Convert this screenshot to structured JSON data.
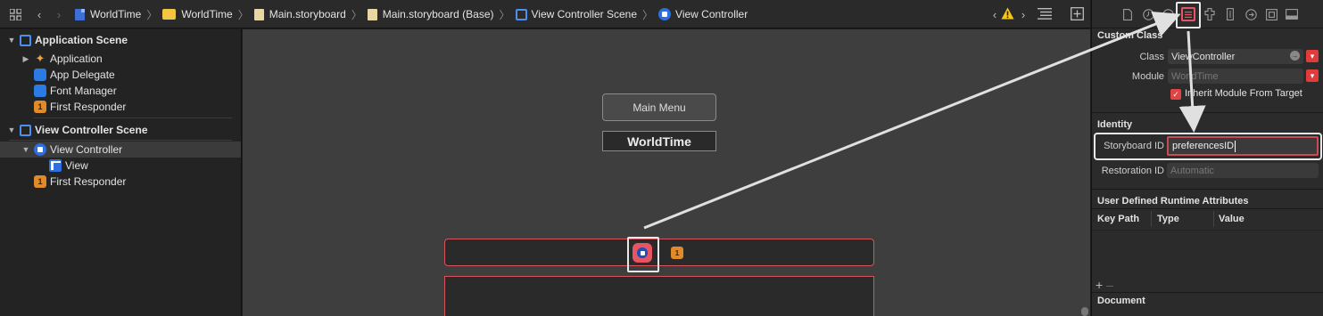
{
  "jumpbar": {
    "crumbs": [
      "WorldTime",
      "WorldTime",
      "Main.storyboard",
      "Main.storyboard (Base)",
      "View Controller Scene",
      "View Controller"
    ],
    "icons": [
      "grid-icon",
      "back-chevron-icon",
      "forward-chevron-icon"
    ],
    "right_icons": [
      "prev-issue-icon",
      "warning-icon",
      "next-issue-icon",
      "list-icon",
      "add-editor-icon"
    ]
  },
  "outline": {
    "scene1": "Application Scene",
    "items1": [
      "Application",
      "App Delegate",
      "Font Manager",
      "First Responder"
    ],
    "scene2": "View Controller Scene",
    "vc": "View Controller",
    "view": "View",
    "fr2": "First Responder"
  },
  "canvas": {
    "button_label": "Main Menu",
    "label_text": "WorldTime"
  },
  "inspector": {
    "custom_class": "Custom Class",
    "class_label": "Class",
    "class_value": "ViewController",
    "module_label": "Module",
    "module_value": "WorldTime",
    "inherit_label": "Inherit Module From Target",
    "identity": "Identity",
    "sbid_label": "Storyboard ID",
    "sbid_value": "preferencesID",
    "restid_label": "Restoration ID",
    "restid_placeholder": "Automatic",
    "udra": "User Defined Runtime Attributes",
    "col_keypath": "Key Path",
    "col_type": "Type",
    "col_value": "Value",
    "document": "Document"
  },
  "colors": {
    "accent_red": "#e85562",
    "selection_border": "#d8545c",
    "vc_blue": "#2d6fe0",
    "canvas_bg": "#3e3e3e"
  }
}
